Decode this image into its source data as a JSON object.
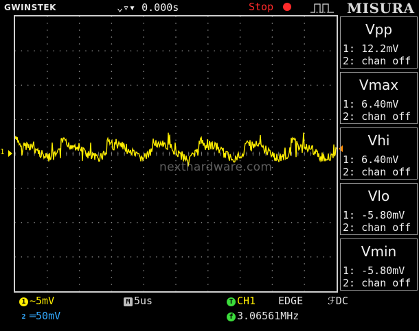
{
  "header": {
    "brand": "GWINSTEK",
    "trigger_position": "0.000s",
    "run_state": "Stop",
    "logo_text": "MISURA"
  },
  "screen": {
    "watermark": "nexthardware.com",
    "channel_marker": "1"
  },
  "measurements": [
    {
      "title": "Vpp",
      "row1": "1: 12.2mV",
      "row2": "2: chan off"
    },
    {
      "title": "Vmax",
      "row1": "1: 6.40mV",
      "row2": "2: chan off"
    },
    {
      "title": "Vhi",
      "row1": "1: 6.40mV",
      "row2": "2: chan off"
    },
    {
      "title": "Vlo",
      "row1": "1: -5.80mV",
      "row2": "2: chan off"
    },
    {
      "title": "Vmin",
      "row1": "1: -5.80mV",
      "row2": "2: chan off"
    }
  ],
  "footer": {
    "ch1_badge": "1",
    "ch1_scale": "5mV",
    "ch2_badge": "2",
    "ch2_scale": "50mV",
    "time_badge": "M",
    "time_scale": "5us",
    "trigger_badge": "T",
    "trigger_source": "CH1",
    "trigger_type": "EDGE",
    "trigger_coupling": "DC",
    "freq_badge": "f",
    "frequency": "3.06561MHz"
  },
  "colors": {
    "ch1": "#ffee00",
    "ch2": "#33aaff",
    "stop": "#ff2a2a",
    "trigger": "#3bdc3b",
    "trigger_level": "#ff8c00"
  },
  "icons": {
    "trigger_position": "arrows-down-icon",
    "stop": "stop-dot-icon",
    "trigger_edge": "rising-edge-pulse-icon",
    "ch1_coupling": "ac-wave-icon",
    "ch2_coupling": "dc-line-icon",
    "trigger_coupling": "rising-edge-icon"
  }
}
